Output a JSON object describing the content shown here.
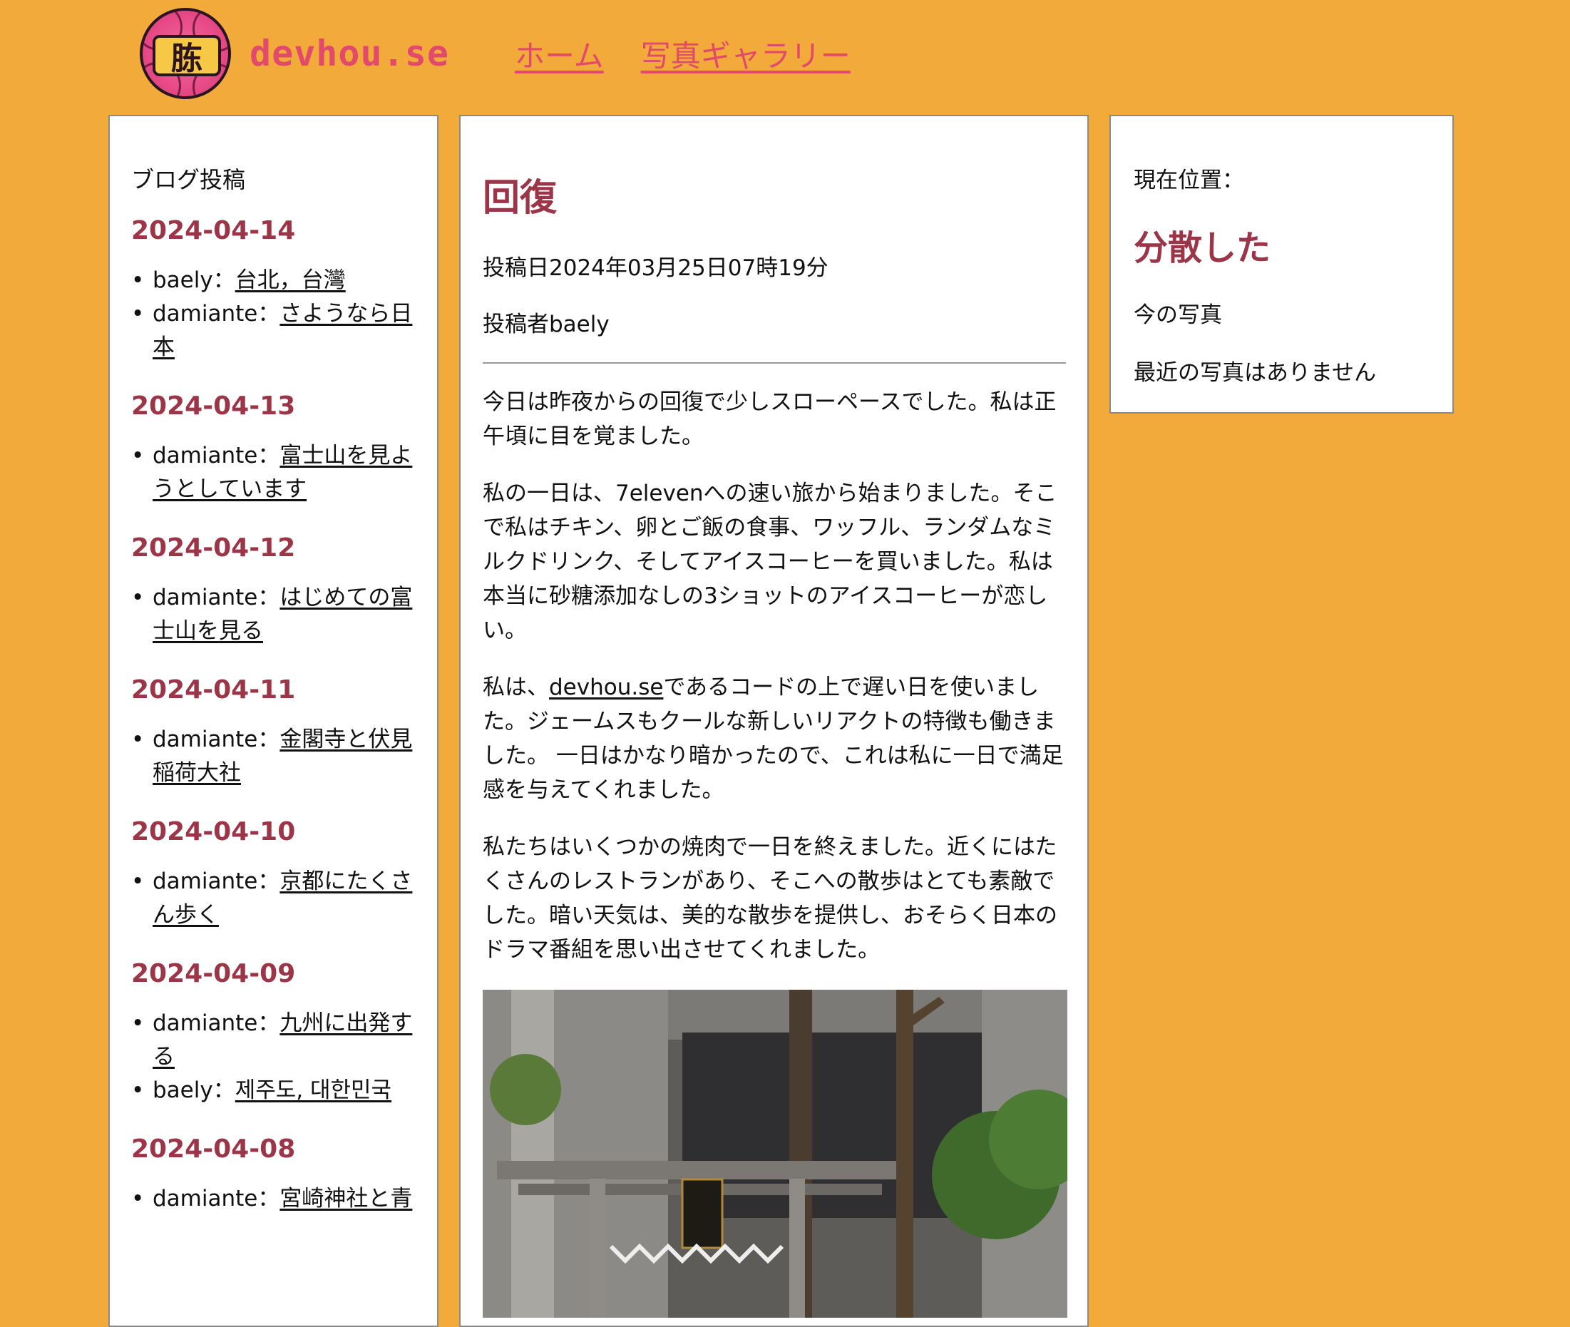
{
  "header": {
    "site_name": "devhou.se",
    "logo_text": "胨",
    "nav": [
      {
        "label": "ホーム"
      },
      {
        "label": "写真ギャラリー"
      }
    ]
  },
  "sidebar": {
    "heading": "ブログ投稿",
    "groups": [
      {
        "date": "2024-04-14",
        "posts": [
          {
            "author": "baely：",
            "title": "台北，台灣"
          },
          {
            "author": "damiante：",
            "title": "さようなら日本"
          }
        ]
      },
      {
        "date": "2024-04-13",
        "posts": [
          {
            "author": "damiante：",
            "title": "富士山を見ようとしています"
          }
        ]
      },
      {
        "date": "2024-04-12",
        "posts": [
          {
            "author": "damiante：",
            "title": "はじめての富士山を見る"
          }
        ]
      },
      {
        "date": "2024-04-11",
        "posts": [
          {
            "author": "damiante：",
            "title": "金閣寺と伏見稲荷大社"
          }
        ]
      },
      {
        "date": "2024-04-10",
        "posts": [
          {
            "author": "damiante：",
            "title": "京都にたくさん歩く"
          }
        ]
      },
      {
        "date": "2024-04-09",
        "posts": [
          {
            "author": "damiante：",
            "title": "九州に出発する"
          },
          {
            "author": "baely：",
            "title": "제주도, 대한민국"
          }
        ]
      },
      {
        "date": "2024-04-08",
        "posts": [
          {
            "author": "damiante：",
            "title": "宮崎神社と青"
          }
        ]
      }
    ]
  },
  "post": {
    "title": "回復",
    "posted_at": "投稿日2024年03月25日07時19分",
    "author": "投稿者baely",
    "paragraphs": {
      "p1": "今日は昨夜からの回復で少しスローペースでした。私は正午頃に目を覚ました。",
      "p2": "私の一日は、7elevenへの速い旅から始まりました。そこで私はチキン、卵とご飯の食事、ワッフル、ランダムなミルクドリンク、そしてアイスコーヒーを買いました。私は本当に砂糖添加なしの3ショットのアイスコーヒーが恋しい。",
      "p3_before": "私は、",
      "p3_link": "devhou.se",
      "p3_after": "であるコードの上で遅い日を使いました。ジェームスもクールな新しいリアクトの特徴も働きました。 一日はかなり暗かったので、これは私に一日で満足感を与えてくれました。",
      "p4": "私たちはいくつかの焼肉で一日を終えました。近くにはたくさんのレストランがあり、そこへの散歩はとても素敵でした。暗い天気は、美的な散歩を提供し、おそらく日本のドラマ番組を思い出させてくれました。"
    }
  },
  "location": {
    "label": "現在位置：",
    "value": "分散した",
    "photos_label": "今の写真",
    "no_photos": "最近の写真はありません"
  }
}
